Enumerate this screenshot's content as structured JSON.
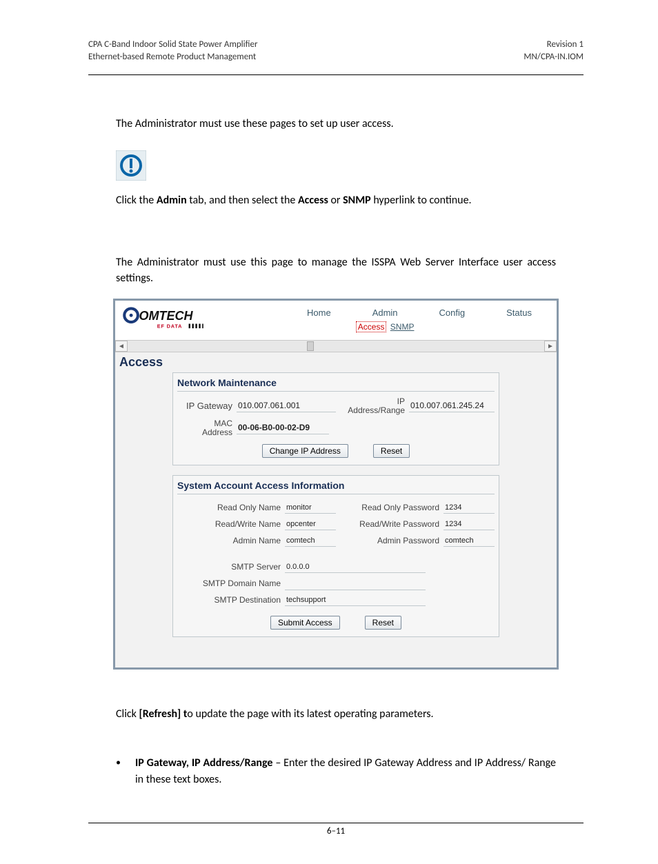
{
  "header": {
    "left1": "CPA C-Band Indoor Solid State Power Amplifier",
    "left2": "Ethernet-based Remote Product Management",
    "right1": "Revision 1",
    "right2": "MN/CPA-IN.IOM"
  },
  "intro1": "The Administrator must use these pages to set up user access.",
  "intro2_a": "Click the ",
  "intro2_b": "Admin",
  "intro2_c": " tab, and then select the ",
  "intro2_d": "Access",
  "intro2_e": " or ",
  "intro2_f": "SNMP",
  "intro2_g": " hyperlink to continue.",
  "intro3": "The Administrator must use this page to manage the ISSPA Web Server Interface user access settings.",
  "screenshot": {
    "logo_primary": "OMTECH",
    "logo_secondary": "EF DATA",
    "tabs": {
      "home": "Home",
      "admin": "Admin",
      "config": "Config",
      "status": "Status"
    },
    "subtabs": {
      "access": "Access",
      "snmp": "SNMP"
    },
    "page_title": "Access",
    "panel1": {
      "title": "Network Maintenance",
      "ip_gateway_label": "IP Gateway",
      "ip_gateway_value": "010.007.061.001",
      "ip_addr_label": "IP\nAddress/Range",
      "ip_addr_value": "010.007.061.245.24",
      "mac_label": "MAC\nAddress",
      "mac_value": "00-06-B0-00-02-D9",
      "btn_change": "Change IP Address",
      "btn_reset": "Reset"
    },
    "panel2": {
      "title": "System Account Access Information",
      "ro_name_label": "Read Only Name",
      "ro_name_value": "monitor",
      "ro_pw_label": "Read Only Password",
      "ro_pw_value": "1234",
      "rw_name_label": "Read/Write Name",
      "rw_name_value": "opcenter",
      "rw_pw_label": "Read/Write Password",
      "rw_pw_value": "1234",
      "admin_name_label": "Admin Name",
      "admin_name_value": "comtech",
      "admin_pw_label": "Admin Password",
      "admin_pw_value": "comtech",
      "smtp_server_label": "SMTP Server",
      "smtp_server_value": "0.0.0.0",
      "smtp_domain_label": "SMTP Domain Name",
      "smtp_domain_value": "",
      "smtp_dest_label": "SMTP Destination",
      "smtp_dest_value": "techsupport",
      "btn_submit": "Submit Access",
      "btn_reset": "Reset"
    }
  },
  "after1_a": "Click ",
  "after1_b": "[Refresh] t",
  "after1_c": "o update the page with its latest operating parameters.",
  "bullet_label": "IP Gateway, IP Address/Range",
  "bullet_text": " – Enter the desired IP Gateway Address and IP Address/ Range in these text boxes.",
  "footer": "6–11"
}
